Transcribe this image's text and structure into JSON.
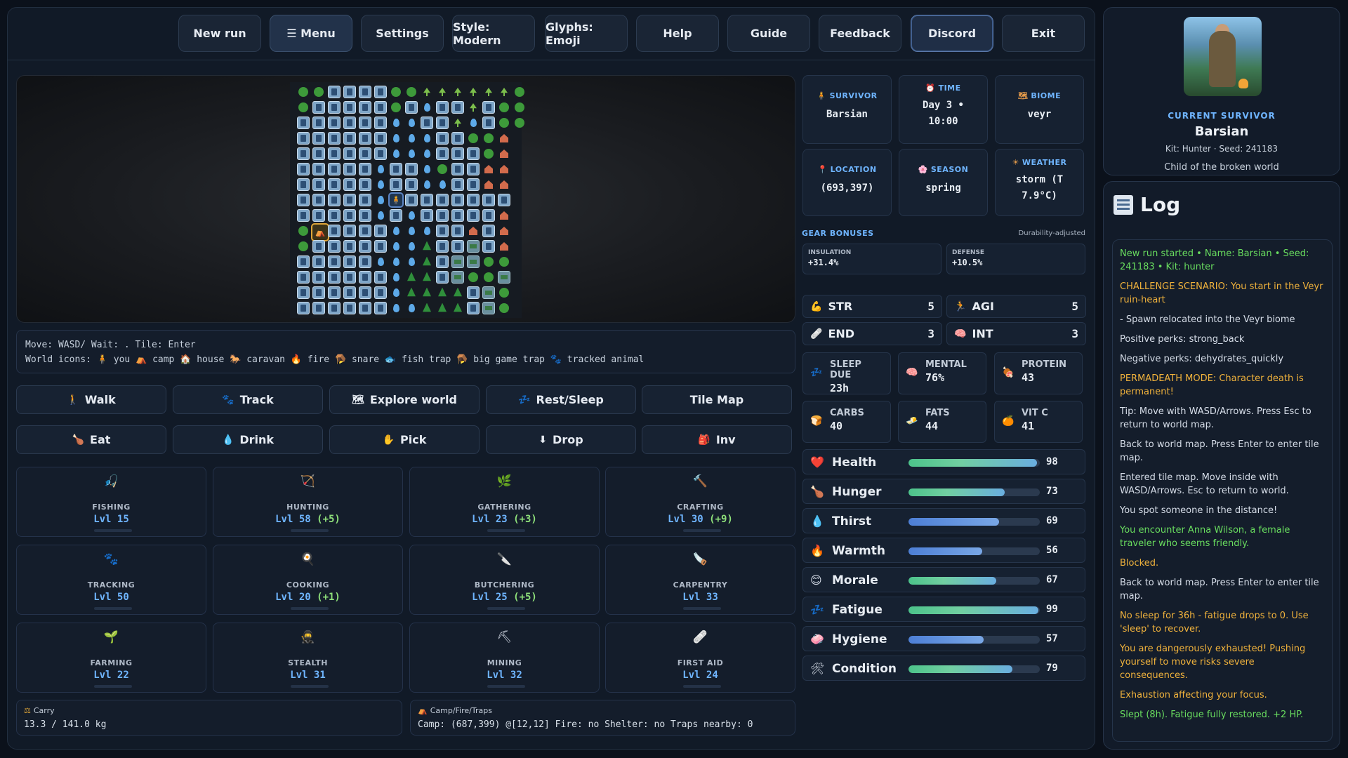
{
  "topbar": [
    {
      "label": "New run"
    },
    {
      "label": "☰ Menu"
    },
    {
      "label": "Settings"
    },
    {
      "label": "Style: Modern"
    },
    {
      "label": "Glyphs: Emoji"
    },
    {
      "label": "Help"
    },
    {
      "label": "Guide"
    },
    {
      "label": "Feedback"
    },
    {
      "label": "Discord"
    },
    {
      "label": "Exit"
    }
  ],
  "help": {
    "line1": "Move: WASD/ Wait: . Tile: Enter",
    "line2": "World icons: 🧍 you ⛺ camp 🏠 house 🐎 caravan 🔥 fire 🪤 snare 🐟 fish trap 🪤 big game trap 🐾 tracked animal"
  },
  "actions_row1": [
    {
      "label": "Walk",
      "icon": "🚶"
    },
    {
      "label": "Track",
      "icon": "🐾"
    },
    {
      "label": "Explore world",
      "icon": "🗺"
    },
    {
      "label": "Rest/Sleep",
      "icon": "💤"
    },
    {
      "label": "Tile Map",
      "icon": ""
    }
  ],
  "actions_row2": [
    {
      "label": "Eat",
      "icon": "🍗"
    },
    {
      "label": "Drink",
      "icon": "💧"
    },
    {
      "label": "Pick",
      "icon": "✋"
    },
    {
      "label": "Drop",
      "icon": "⬇"
    },
    {
      "label": "Inv",
      "icon": "🎒"
    }
  ],
  "skills": [
    {
      "name": "FISHING",
      "level": "Lvl 15",
      "bonus": "",
      "icon": "🎣"
    },
    {
      "name": "HUNTING",
      "level": "Lvl 58",
      "bonus": "(+5)",
      "icon": "🏹"
    },
    {
      "name": "GATHERING",
      "level": "Lvl 23",
      "bonus": "(+3)",
      "icon": "🌿"
    },
    {
      "name": "CRAFTING",
      "level": "Lvl 30",
      "bonus": "(+9)",
      "icon": "🔨"
    },
    {
      "name": "TRACKING",
      "level": "Lvl 50",
      "bonus": "",
      "icon": "🐾"
    },
    {
      "name": "COOKING",
      "level": "Lvl 20",
      "bonus": "(+1)",
      "icon": "🍳"
    },
    {
      "name": "BUTCHERING",
      "level": "Lvl 25",
      "bonus": "(+5)",
      "icon": "🔪"
    },
    {
      "name": "CARPENTRY",
      "level": "Lvl 33",
      "bonus": "",
      "icon": "🪚"
    },
    {
      "name": "FARMING",
      "level": "Lvl 22",
      "bonus": "",
      "icon": "🌱"
    },
    {
      "name": "STEALTH",
      "level": "Lvl 31",
      "bonus": "",
      "icon": "🥷"
    },
    {
      "name": "MINING",
      "level": "Lvl 32",
      "bonus": "",
      "icon": "⛏"
    },
    {
      "name": "FIRST AID",
      "level": "Lvl 24",
      "bonus": "",
      "icon": "🩹"
    }
  ],
  "carry": {
    "label": "Carry",
    "value": "13.3 / 141.0 kg"
  },
  "camp": {
    "label": "Camp/Fire/Traps",
    "value": "Camp: (687,399) @[12,12] Fire: no Shelter: no Traps nearby: 0"
  },
  "info": {
    "survivor": {
      "label": "SURVIVOR",
      "value": "Barsian"
    },
    "time": {
      "label": "TIME",
      "value1": "Day 3 •",
      "value2": "10:00"
    },
    "biome": {
      "label": "BIOME",
      "value": "veyr"
    },
    "location": {
      "label": "LOCATION",
      "value": "(693,397)"
    },
    "season": {
      "label": "SEASON",
      "value": "spring"
    },
    "weather": {
      "label": "WEATHER",
      "value1": "storm (T",
      "value2": "7.9°C)"
    }
  },
  "gear": {
    "title": "GEAR BONUSES",
    "note": "Durability-adjusted",
    "insulation": {
      "label": "INSULATION",
      "value": "+31.4%"
    },
    "defense": {
      "label": "DEFENSE",
      "value": "+10.5%"
    }
  },
  "attributes": [
    {
      "label": "STR",
      "value": "5",
      "icon": "💪"
    },
    {
      "label": "AGI",
      "value": "5",
      "icon": "🏃"
    },
    {
      "label": "END",
      "value": "3",
      "icon": "🩹"
    },
    {
      "label": "INT",
      "value": "3",
      "icon": "🧠"
    }
  ],
  "nutrition": [
    {
      "label": "SLEEP DUE",
      "value": "23h",
      "icon": "💤"
    },
    {
      "label": "MENTAL",
      "value": "76%",
      "icon": "🧠"
    },
    {
      "label": "PROTEIN",
      "value": "43",
      "icon": "🍖"
    },
    {
      "label": "CARBS",
      "value": "40",
      "icon": "🍞"
    },
    {
      "label": "FATS",
      "value": "44",
      "icon": "🧈"
    },
    {
      "label": "VIT C",
      "value": "41",
      "icon": "🍊"
    }
  ],
  "stats": [
    {
      "label": "Health",
      "value": 98,
      "icon": "❤️",
      "style": "green"
    },
    {
      "label": "Hunger",
      "value": 73,
      "icon": "🍗",
      "style": "green"
    },
    {
      "label": "Thirst",
      "value": 69,
      "icon": "💧",
      "style": "blue"
    },
    {
      "label": "Warmth",
      "value": 56,
      "icon": "🔥",
      "style": "blue"
    },
    {
      "label": "Morale",
      "value": 67,
      "icon": "😊",
      "style": "green"
    },
    {
      "label": "Fatigue",
      "value": 99,
      "icon": "💤",
      "style": "green"
    },
    {
      "label": "Hygiene",
      "value": 57,
      "icon": "🧼",
      "style": "blue"
    },
    {
      "label": "Condition",
      "value": 79,
      "icon": "🛠",
      "style": "green"
    }
  ],
  "survivor_card": {
    "heading": "CURRENT SURVIVOR",
    "name": "Barsian",
    "kit": "Kit: Hunter · Seed: 241183",
    "subtitle": "Child of the broken world"
  },
  "log": {
    "title": "Log",
    "entries": [
      {
        "text": "New run started • Name: Barsian • Seed: 241183 • Kit: hunter",
        "color": "green"
      },
      {
        "text": "CHALLENGE SCENARIO: You start in the Veyr ruin-heart",
        "color": "orange"
      },
      {
        "text": "- Spawn relocated into the Veyr biome",
        "color": "white"
      },
      {
        "text": "Positive perks: strong_back",
        "color": "white"
      },
      {
        "text": "Negative perks: dehydrates_quickly",
        "color": "white"
      },
      {
        "text": "PERMADEATH MODE: Character death is permanent!",
        "color": "orange"
      },
      {
        "text": "Tip: Move with WASD/Arrows. Press Esc to return to world map.",
        "color": "white"
      },
      {
        "text": "Back to world map. Press Enter to enter tile map.",
        "color": "white"
      },
      {
        "text": "Entered tile map. Move inside with WASD/Arrows. Esc to return to world.",
        "color": "white"
      },
      {
        "text": "You spot someone in the distance!",
        "color": "white"
      },
      {
        "text": "You encounter Anna Wilson, a female traveler who seems friendly.",
        "color": "green"
      },
      {
        "text": "Blocked.",
        "color": "orange"
      },
      {
        "text": "Back to world map. Press Enter to enter tile map.",
        "color": "white"
      },
      {
        "text": "No sleep for 36h - fatigue drops to 0. Use 'sleep' to recover.",
        "color": "orange"
      },
      {
        "text": "You are dangerously exhausted! Pushing yourself to move risks severe consequences.",
        "color": "orange"
      },
      {
        "text": "Exhaustion affecting your focus.",
        "color": "orange"
      },
      {
        "text": "Slept (8h). Fatigue fully restored. +2 HP.",
        "color": "green"
      }
    ]
  },
  "map_rows": [
    "ffbbbbffssssssf",
    "fbbbbbfbwbbsbff",
    "bbbbbbwwbbswbff",
    "bbbbbbwwwbbffh",
    "bbbbbbwwwbbbfh",
    "bbbbbwbbwfbbhh",
    "bbbbbwbbwwbbhh",
    "bbbbbwYbbbbbbb",
    "bbbbbwbwbbbbbh",
    "fCbbbbwwwbbhbh",
    "fbbbbbwwpbbgbh",
    "bbbbbwwwpbggff",
    "bbbbbbwppbgffg",
    "bbbbbbwppppbgf",
    "bbbbbbwwpppbgf"
  ]
}
